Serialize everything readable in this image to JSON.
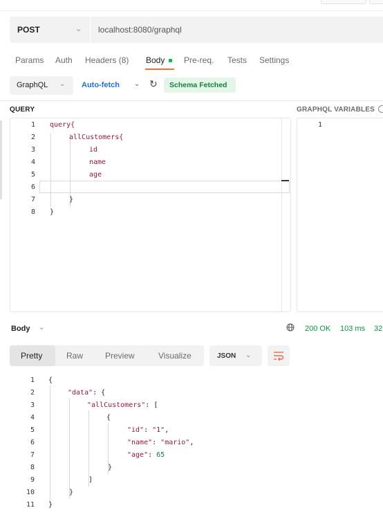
{
  "request": {
    "method": "POST",
    "url": "localhost:8080/graphql"
  },
  "tabs": {
    "params": "Params",
    "auth": "Auth",
    "headers": "Headers (8)",
    "body": "Body",
    "prereq": "Pre-req.",
    "tests": "Tests",
    "settings": "Settings"
  },
  "toolbar": {
    "body_type": "GraphQL",
    "auto_fetch": "Auto-fetch",
    "schema_status": "Schema Fetched"
  },
  "query_panel": {
    "title": "QUERY",
    "lines": [
      {
        "num": "1",
        "text": "query{"
      },
      {
        "num": "2",
        "text": "allCustomers{"
      },
      {
        "num": "3",
        "text": "id"
      },
      {
        "num": "4",
        "text": "name"
      },
      {
        "num": "5",
        "text": "age"
      },
      {
        "num": "6",
        "text": ""
      },
      {
        "num": "7",
        "text": "}"
      },
      {
        "num": "8",
        "text": "}"
      }
    ]
  },
  "variables_panel": {
    "title": "GRAPHQL VARIABLES",
    "lines": [
      {
        "num": "1",
        "text": ""
      }
    ]
  },
  "response": {
    "label": "Body",
    "status": "200 OK",
    "time": "103 ms",
    "size": "32",
    "view_tabs": [
      "Pretty",
      "Raw",
      "Preview",
      "Visualize"
    ],
    "active_view": "Pretty",
    "format": "JSON",
    "lines": [
      {
        "num": "1",
        "indent": 0,
        "text": "{"
      },
      {
        "num": "2",
        "indent": 1,
        "key": "\"data\"",
        "rest": ": {"
      },
      {
        "num": "3",
        "indent": 2,
        "key": "\"allCustomers\"",
        "rest": ": ["
      },
      {
        "num": "4",
        "indent": 3,
        "text": "{"
      },
      {
        "num": "5",
        "indent": 4,
        "key": "\"id\"",
        "rest": ": ",
        "str": "\"1\"",
        "tail": ","
      },
      {
        "num": "6",
        "indent": 4,
        "key": "\"name\"",
        "rest": ": ",
        "str": "\"mario\"",
        "tail": ","
      },
      {
        "num": "7",
        "indent": 4,
        "key": "\"age\"",
        "rest": ": ",
        "num_val": "65"
      },
      {
        "num": "8",
        "indent": 3,
        "text": "}"
      },
      {
        "num": "9",
        "indent": 2,
        "text": "]"
      },
      {
        "num": "10",
        "indent": 1,
        "text": "}"
      },
      {
        "num": "11",
        "indent": 0,
        "text": "}"
      }
    ]
  },
  "colors": {
    "accent_orange": "#ff6c37",
    "link_blue": "#1f6fd8",
    "success_green": "#0b9444",
    "code_keyword": "#8b1a3e"
  }
}
